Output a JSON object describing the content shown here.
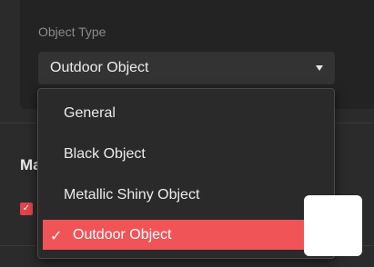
{
  "object_type": {
    "label": "Object Type",
    "selected": "Outdoor Object"
  },
  "dropdown": {
    "options": [
      {
        "label": "General",
        "selected": false
      },
      {
        "label": "Black Object",
        "selected": false
      },
      {
        "label": "Metallic Shiny Object",
        "selected": false
      },
      {
        "label": "Outdoor Object",
        "selected": true
      }
    ],
    "check_glyph": "✓"
  },
  "section": {
    "heading_partial": "Ma"
  },
  "checkbox": {
    "checked": true,
    "glyph": "✓"
  },
  "colors": {
    "accent": "#f15457",
    "checkbox": "#e0444c",
    "background": "#2b2b2b",
    "panel": "#232323"
  }
}
